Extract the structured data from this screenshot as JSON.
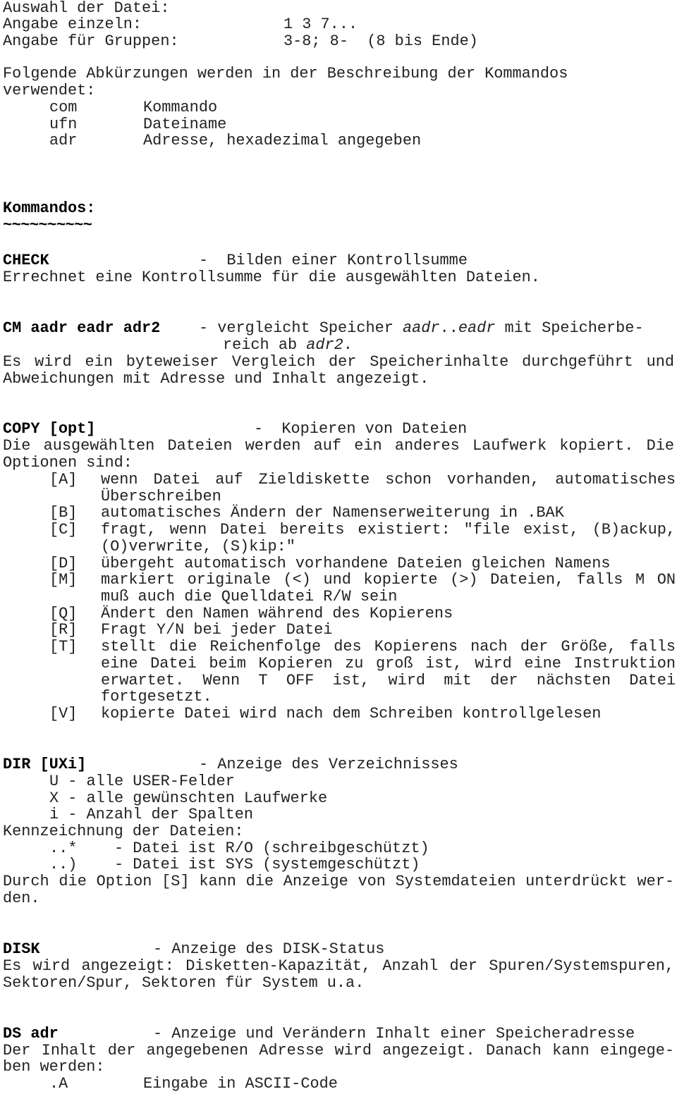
{
  "selection": {
    "title": "Auswahl der Datei:",
    "single_label": "Angabe einzeln:",
    "single_value": "1 3 7...",
    "group_label": "Angabe für Gruppen:",
    "group_value": "3-8; 8-  (8 bis Ende)"
  },
  "abbreviations": {
    "intro_line1": "Folgende Abkürzungen werden in der Beschreibung der Kommandos",
    "intro_line2": "verwendet:",
    "items": [
      {
        "abbr": "com",
        "meaning": "Kommando"
      },
      {
        "abbr": "ufn",
        "meaning": "Dateiname"
      },
      {
        "abbr": "adr",
        "meaning": "Adresse, hexadezimal angegeben"
      }
    ]
  },
  "commands_heading": "Kommandos:",
  "commands_underline": "~~~~~~~~~~",
  "commands": {
    "check": {
      "name": "CHECK",
      "summary": "-  Bilden einer Kontrollsumme",
      "desc": [
        "Errechnet eine Kontrollsumme für die ausgewählten Dateien."
      ]
    },
    "cm": {
      "name": "CM aadr eadr adr2",
      "summary_dash": "- vergleicht Speicher",
      "summary_arg1": "aadr",
      "summary_sep": "..",
      "summary_arg2": "eadr",
      "summary_rest": " mit Speicherbe-",
      "summary_line2_pre": "reich ab ",
      "summary_line2_arg": "adr2",
      "summary_line2_post": ".",
      "desc": [
        "Es wird ein byteweiser Vergleich der Speicherinhalte durchgeführt und",
        "Abweichungen mit Adresse und Inhalt angezeigt."
      ]
    },
    "copy": {
      "name": "COPY [opt]",
      "summary": "-  Kopieren von Dateien",
      "desc": [
        "Die ausgewählten Dateien werden auf ein anderes Laufwerk kopiert. Die",
        "Optionen sind:"
      ],
      "options": [
        {
          "key": "[A]",
          "lines": [
            "wenn Datei auf Zieldiskette schon vorhanden, automatisches",
            "Überschreiben"
          ]
        },
        {
          "key": "[B]",
          "lines": [
            "automatisches Ändern der Namenserweiterung in .BAK"
          ]
        },
        {
          "key": "[C]",
          "lines": [
            "fragt, wenn Datei bereits existiert: \"file exist, (B)ackup,",
            "(O)verwrite, (S)kip:\""
          ]
        },
        {
          "key": "[D]",
          "lines": [
            "übergeht automatisch vorhandene Dateien gleichen Namens"
          ]
        },
        {
          "key": "[M]",
          "lines": [
            "markiert originale (<) und kopierte (>) Dateien, falls M ON",
            "muß auch die Quelldatei R/W sein"
          ]
        },
        {
          "key": "[Q]",
          "lines": [
            "Ändert den Namen während des Kopierens"
          ]
        },
        {
          "key": "[R]",
          "lines": [
            "Fragt Y/N bei jeder Datei"
          ]
        },
        {
          "key": "[T]",
          "lines": [
            "stellt die Reichenfolge des Kopierens nach der Größe, falls",
            "eine Datei beim Kopieren zu groß ist, wird eine Instruktion",
            "erwartet. Wenn T OFF ist, wird mit der nächsten Datei",
            "fortgesetzt."
          ]
        },
        {
          "key": "[V]",
          "lines": [
            "kopierte Datei wird nach dem Schreiben kontrollgelesen"
          ]
        }
      ]
    },
    "dir": {
      "name": "DIR [UXi]",
      "summary": "- Anzeige des Verzeichnisses",
      "params": [
        "U - alle USER-Felder",
        "X - alle gewünschten Laufwerke",
        "i - Anzahl der Spalten"
      ],
      "marks_title": "Kennzeichnung der Dateien:",
      "marks": [
        "..*    - Datei ist R/O (schreibgeschützt)",
        "..)    - Datei ist SYS (systemgeschützt)"
      ],
      "desc": [
        "Durch die Option [S] kann die Anzeige von Systemdateien unterdrückt wer-",
        "den."
      ]
    },
    "disk": {
      "name": "DISK",
      "summary": "- Anzeige des DISK-Status",
      "desc": [
        "Es wird angezeigt: Disketten-Kapazität, Anzahl der Spuren/Systemspuren,",
        "Sektoren/Spur, Sektoren für System u.a."
      ]
    },
    "ds": {
      "name": "DS adr",
      "summary": "- Anzeige und Verändern Inhalt einer Speicheradresse",
      "desc": [
        "Der Inhalt der angegebenen Adresse wird angezeigt. Danach kann eingege-",
        "ben werden:"
      ],
      "inputs": [
        {
          "key": ".A",
          "meaning": "Eingabe in ASCII-Code"
        }
      ]
    }
  }
}
